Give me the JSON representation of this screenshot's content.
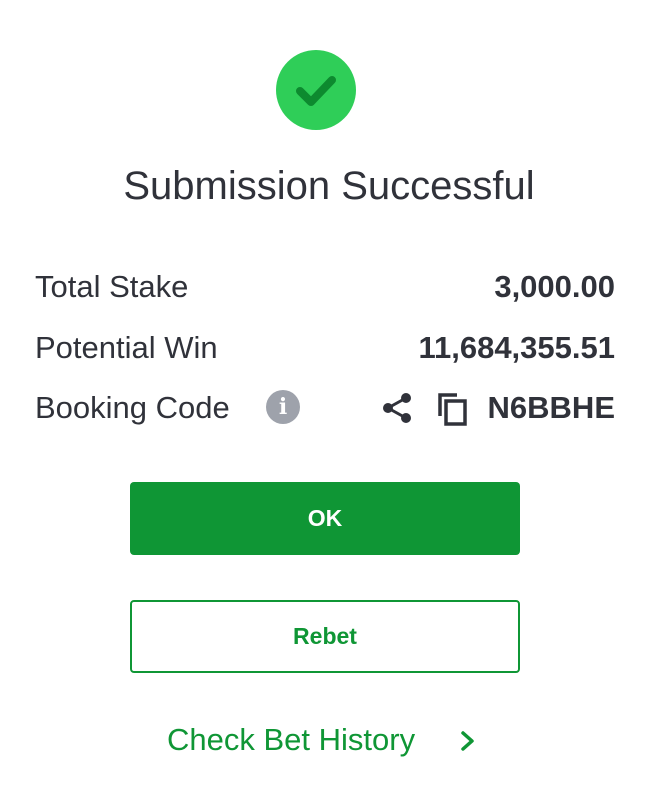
{
  "icons": {
    "success": "check-circle-icon",
    "info": "info-icon",
    "share": "share-icon",
    "copy": "copy-icon",
    "chevron": "chevron-right-icon"
  },
  "colors": {
    "success_circle": "#2fce58",
    "success_check": "#0d8a2f",
    "primary_green": "#0f9635",
    "text_dark": "#30323a",
    "info_gray": "#9ea2ab"
  },
  "header": {
    "title": "Submission Successful"
  },
  "summary": {
    "total_stake": {
      "label": "Total Stake",
      "value": "3,000.00"
    },
    "potential_win": {
      "label": "Potential Win",
      "value": "11,684,355.51"
    },
    "booking_code": {
      "label": "Booking Code",
      "info_glyph": "i",
      "value": "N6BBHE"
    }
  },
  "actions": {
    "ok_label": "OK",
    "rebet_label": "Rebet",
    "history_label": "Check Bet History"
  }
}
